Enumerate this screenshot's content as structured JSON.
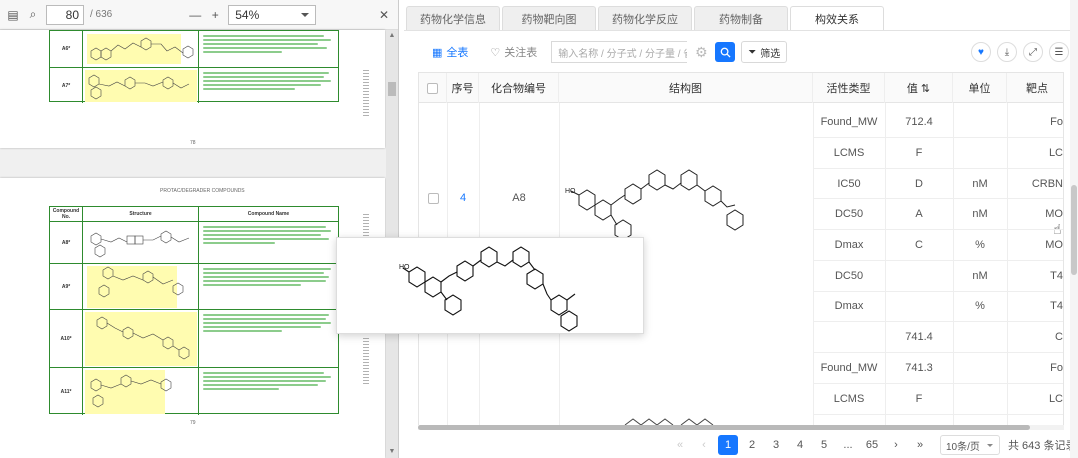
{
  "pdf": {
    "page_current": "80",
    "page_total": "/ 636",
    "zoom": "54%",
    "page1_number": "78",
    "page2_header": "PROTAC/DEGRADER COMPOUNDS",
    "page2_number": "79",
    "table_header": {
      "col1": "Compound No.",
      "col2": "Structure",
      "col3": "Compound Name"
    },
    "page1_rows": [
      {
        "id": "A6*"
      },
      {
        "id": "A7*"
      }
    ],
    "page2_rows": [
      {
        "id": "A8*"
      },
      {
        "id": "A9*"
      },
      {
        "id": "A10*"
      },
      {
        "id": "A11*"
      }
    ]
  },
  "tabs": [
    {
      "label": "药物化学信息",
      "active": false
    },
    {
      "label": "药物靶向图",
      "active": false
    },
    {
      "label": "药物化学反应",
      "active": false
    },
    {
      "label": "药物制备",
      "active": false
    },
    {
      "label": "构效关系",
      "active": true
    }
  ],
  "toolbar": {
    "all_label": "全表",
    "fav_label": "关注表",
    "search_placeholder": "输入名称 / 分子式 / 分子量 / 省",
    "filter_label": "筛选"
  },
  "table": {
    "columns": [
      "序号",
      "化合物编号",
      "结构图",
      "活性类型",
      "值",
      "单位",
      "靶点"
    ],
    "row": {
      "index": "4",
      "compound": "A8"
    },
    "cells": [
      {
        "type": "Found_MW",
        "value": "712.4",
        "unit": "",
        "target": "Fo"
      },
      {
        "type": "LCMS",
        "value": "F",
        "unit": "",
        "target": "LC"
      },
      {
        "type": "IC50",
        "value": "D",
        "unit": "nM",
        "target": "CRBN"
      },
      {
        "type": "DC50",
        "value": "A",
        "unit": "nM",
        "target": "MO"
      },
      {
        "type": "Dmax",
        "value": "C",
        "unit": "%",
        "target": "MO"
      },
      {
        "type": "DC50",
        "value": "",
        "unit": "nM",
        "target": "T4"
      },
      {
        "type": "Dmax",
        "value": "",
        "unit": "%",
        "target": "T4"
      },
      {
        "type": "",
        "value": "741.4",
        "unit": "",
        "target": "C"
      },
      {
        "type": "Found_MW",
        "value": "741.3",
        "unit": "",
        "target": "Fo"
      },
      {
        "type": "LCMS",
        "value": "F",
        "unit": "",
        "target": "LC"
      }
    ]
  },
  "pagination": {
    "pages": [
      "1",
      "2",
      "3",
      "4",
      "5",
      "...",
      "65"
    ],
    "active": "1",
    "page_size": "10条/页",
    "total": "共 643 条记录"
  },
  "colors": {
    "accent": "#1677ff",
    "pdf_green": "#2e8b2e",
    "highlight": "#fffcb0"
  }
}
